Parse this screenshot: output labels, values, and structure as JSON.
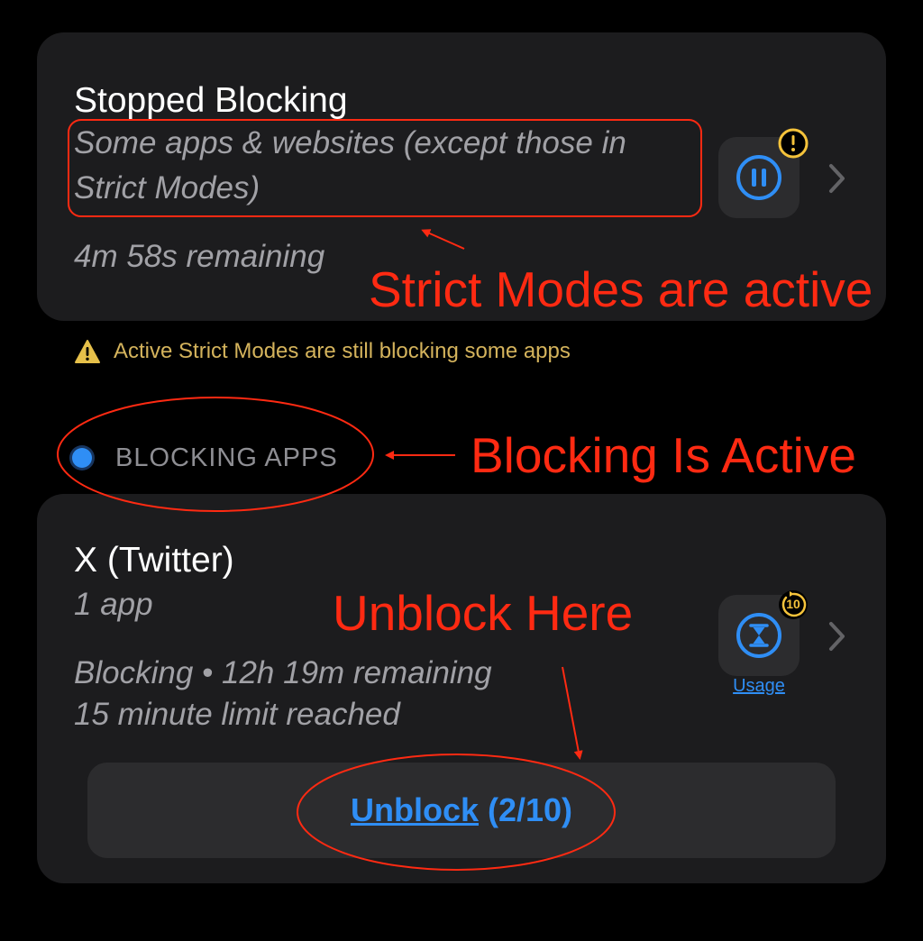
{
  "card1": {
    "title": "Stopped Blocking",
    "subtitle_line1": "Some apps & websites (except those in",
    "subtitle_line2": "Strict Modes)",
    "remaining": "4m 58s remaining",
    "icon": "pause-icon",
    "badge_icon": "exclamation-badge-icon"
  },
  "warning": {
    "icon": "warning-triangle-icon",
    "text": "Active Strict Modes are still blocking some apps"
  },
  "section": {
    "label": "BLOCKING APPS"
  },
  "card2": {
    "title": "X (Twitter)",
    "subtitle": "1 app",
    "status_line1": "Blocking • 12h 19m remaining",
    "status_line2": "15 minute limit reached",
    "icon": "hourglass-icon",
    "badge_icon": "replay-10-badge-icon",
    "badge_text": "10",
    "usage_label": "Usage",
    "unblock_label": "Unblock",
    "unblock_count": "(2/10)"
  },
  "annotations": {
    "strict_modes": "Strict Modes are active",
    "blocking_active": "Blocking Is Active",
    "unblock_here": "Unblock Here"
  },
  "colors": {
    "background": "#000000",
    "card": "#1c1c1e",
    "tile": "#2c2c2e",
    "accent_blue": "#2f8ef5",
    "badge_yellow": "#f5c33b",
    "warning_text": "#d4b35c",
    "annotation_red": "#ff2a12"
  }
}
